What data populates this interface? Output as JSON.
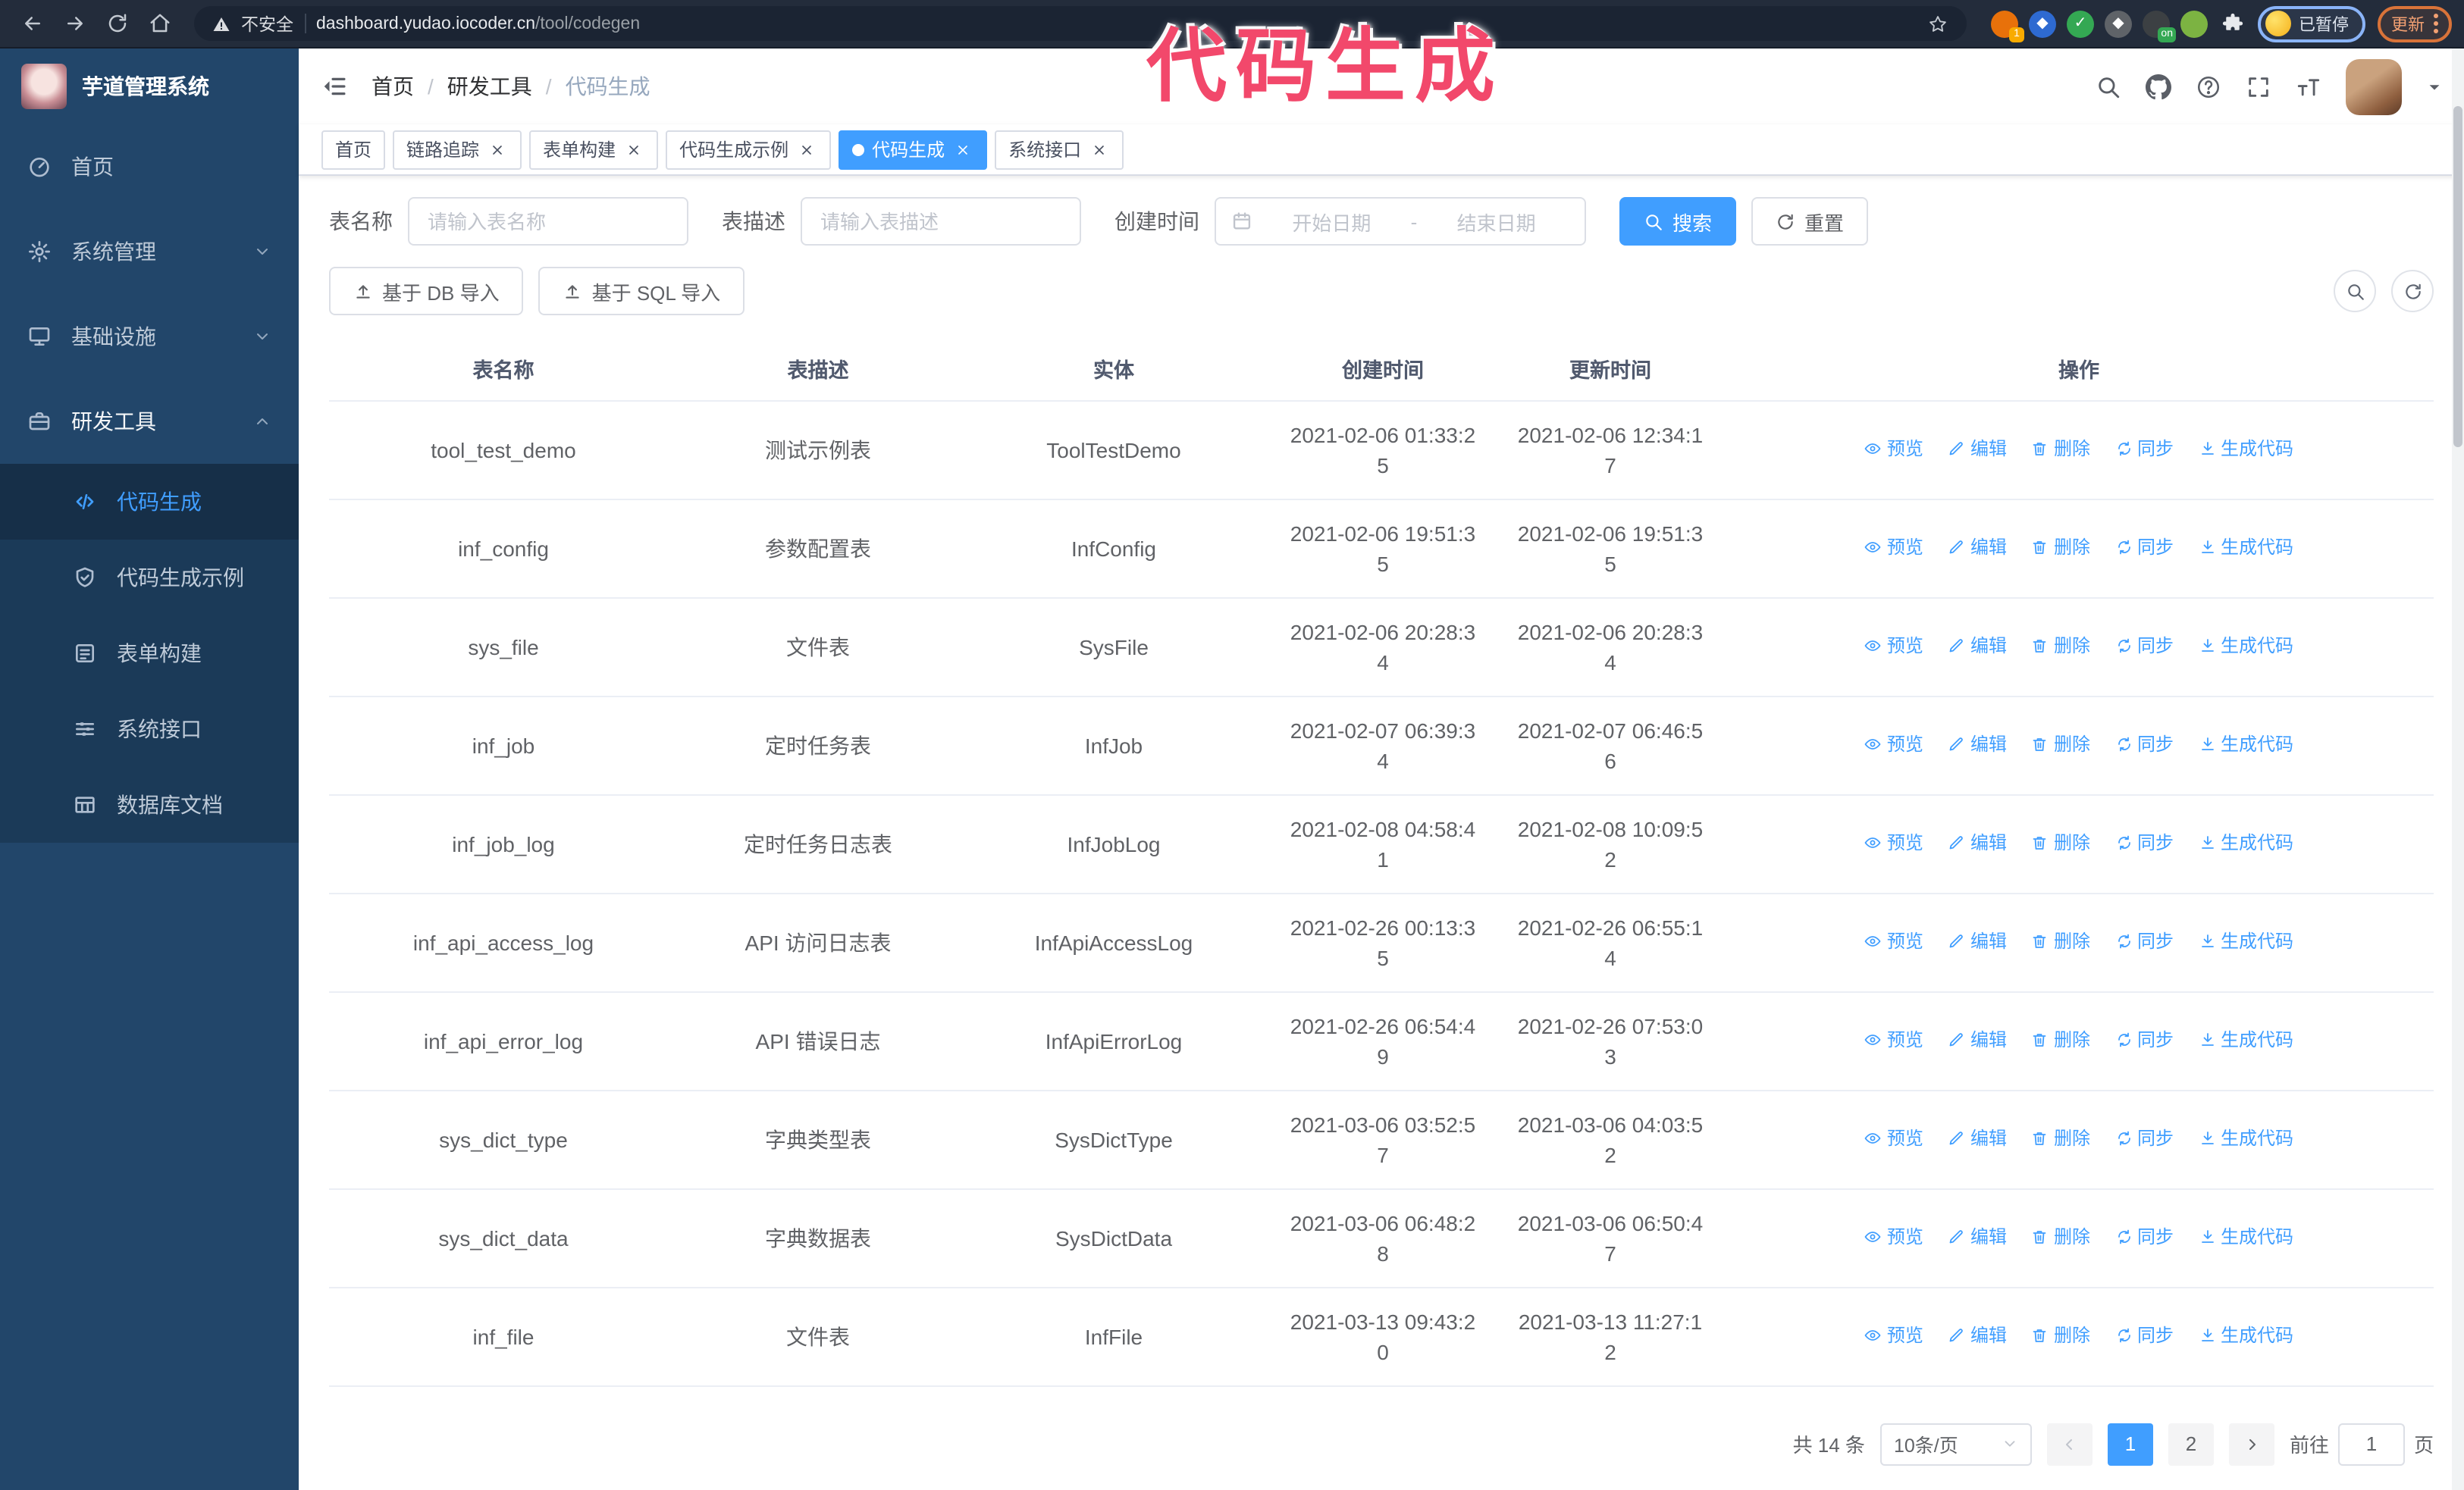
{
  "colors": {
    "primary": "#409eff",
    "sidebar_bg": "#22466a",
    "submenu_bg": "#1b3a58",
    "annotation": "#f2486b"
  },
  "annotation": {
    "text": "代码生成"
  },
  "browser": {
    "nav_icons": [
      "back-icon",
      "forward-icon",
      "reload-icon",
      "home-icon"
    ],
    "security_label": "不安全",
    "url_host": "dashboard.yudao.iocoder.cn",
    "url_path": "/tool/codegen",
    "extensions": [
      {
        "name": "extension-orange-icon",
        "color": "#e8710a",
        "badge": "1",
        "badge_color": "#f9ab00"
      },
      {
        "name": "extension-gem-icon",
        "color": "#2e6ad1",
        "glyph": "◆"
      },
      {
        "name": "extension-check-icon",
        "color": "#34a853",
        "glyph": "✓"
      },
      {
        "name": "extension-grid-icon",
        "color": "#5f6368",
        "glyph": "◆"
      },
      {
        "name": "extension-dark-icon",
        "color": "#3c4043",
        "badge": "on",
        "badge_color": "#34a853"
      },
      {
        "name": "extension-green-icon",
        "color": "#7cb342"
      },
      {
        "name": "puzzle-icon",
        "color": "transparent"
      }
    ],
    "profile": {
      "status_label": "已暂停"
    },
    "update_label": "更新"
  },
  "sidebar": {
    "title": "芋道管理系统",
    "items": [
      {
        "name": "home",
        "label": "首页",
        "icon": "dashboard-icon"
      },
      {
        "name": "system-management",
        "label": "系统管理",
        "icon": "gear-icon",
        "chevron": "down"
      },
      {
        "name": "infrastructure",
        "label": "基础设施",
        "icon": "infrastructure-icon",
        "chevron": "down"
      },
      {
        "name": "dev-tools",
        "label": "研发工具",
        "icon": "toolbox-icon",
        "chevron": "up",
        "expanded": true,
        "children": [
          {
            "name": "code-generation",
            "label": "代码生成",
            "icon": "code-icon",
            "active": true
          },
          {
            "name": "code-generation-example",
            "label": "代码生成示例",
            "icon": "example-icon"
          },
          {
            "name": "form-builder",
            "label": "表单构建",
            "icon": "form-icon"
          },
          {
            "name": "system-api",
            "label": "系统接口",
            "icon": "api-icon"
          },
          {
            "name": "database-doc",
            "label": "数据库文档",
            "icon": "dbdoc-icon"
          }
        ]
      }
    ]
  },
  "header": {
    "breadcrumb": {
      "separator": "/",
      "items": [
        {
          "label": "首页",
          "current": false
        },
        {
          "label": "研发工具",
          "current": false
        },
        {
          "label": "代码生成",
          "current": true
        }
      ]
    },
    "icons": [
      "search-icon",
      "github-icon",
      "question-icon",
      "fullscreen-icon",
      "font-size-icon"
    ]
  },
  "tabs": [
    {
      "label": "首页",
      "closable": false,
      "active": false
    },
    {
      "label": "链路追踪",
      "closable": true,
      "active": false
    },
    {
      "label": "表单构建",
      "closable": true,
      "active": false
    },
    {
      "label": "代码生成示例",
      "closable": true,
      "active": false
    },
    {
      "label": "代码生成",
      "closable": true,
      "active": true
    },
    {
      "label": "系统接口",
      "closable": true,
      "active": false
    }
  ],
  "filters": {
    "table_name_label": "表名称",
    "table_name_placeholder": "请输入表名称",
    "table_desc_label": "表描述",
    "table_desc_placeholder": "请输入表描述",
    "create_time_label": "创建时间",
    "date_start_placeholder": "开始日期",
    "date_separator": "-",
    "date_end_placeholder": "结束日期",
    "search_label": "搜索",
    "reset_label": "重置"
  },
  "toolbar": {
    "import_db_label": "基于 DB 导入",
    "import_sql_label": "基于 SQL 导入"
  },
  "table": {
    "columns": [
      "表名称",
      "表描述",
      "实体",
      "创建时间",
      "更新时间",
      "操作"
    ],
    "actions": [
      {
        "name": "preview",
        "label": "预览",
        "icon": "eye-icon"
      },
      {
        "name": "edit",
        "label": "编辑",
        "icon": "edit-icon"
      },
      {
        "name": "delete",
        "label": "删除",
        "icon": "delete-icon"
      },
      {
        "name": "sync",
        "label": "同步",
        "icon": "sync-icon"
      },
      {
        "name": "generate-code",
        "label": "生成代码",
        "icon": "download-icon"
      }
    ],
    "rows": [
      {
        "name": "tool_test_demo",
        "desc": "测试示例表",
        "entity": "ToolTestDemo",
        "created": "2021-02-06 01:33:25",
        "updated": "2021-02-06 12:34:17"
      },
      {
        "name": "inf_config",
        "desc": "参数配置表",
        "entity": "InfConfig",
        "created": "2021-02-06 19:51:35",
        "updated": "2021-02-06 19:51:35"
      },
      {
        "name": "sys_file",
        "desc": "文件表",
        "entity": "SysFile",
        "created": "2021-02-06 20:28:34",
        "updated": "2021-02-06 20:28:34"
      },
      {
        "name": "inf_job",
        "desc": "定时任务表",
        "entity": "InfJob",
        "created": "2021-02-07 06:39:34",
        "updated": "2021-02-07 06:46:56"
      },
      {
        "name": "inf_job_log",
        "desc": "定时任务日志表",
        "entity": "InfJobLog",
        "created": "2021-02-08 04:58:41",
        "updated": "2021-02-08 10:09:52"
      },
      {
        "name": "inf_api_access_log",
        "desc": "API 访问日志表",
        "entity": "InfApiAccessLog",
        "created": "2021-02-26 00:13:35",
        "updated": "2021-02-26 06:55:14"
      },
      {
        "name": "inf_api_error_log",
        "desc": "API 错误日志",
        "entity": "InfApiErrorLog",
        "created": "2021-02-26 06:54:49",
        "updated": "2021-02-26 07:53:03"
      },
      {
        "name": "sys_dict_type",
        "desc": "字典类型表",
        "entity": "SysDictType",
        "created": "2021-03-06 03:52:57",
        "updated": "2021-03-06 04:03:52"
      },
      {
        "name": "sys_dict_data",
        "desc": "字典数据表",
        "entity": "SysDictData",
        "created": "2021-03-06 06:48:28",
        "updated": "2021-03-06 06:50:47"
      },
      {
        "name": "inf_file",
        "desc": "文件表",
        "entity": "InfFile",
        "created": "2021-03-13 09:43:20",
        "updated": "2021-03-13 11:27:12"
      }
    ]
  },
  "pagination": {
    "total_label": "共 14 条",
    "page_size": "10条/页",
    "pages": [
      "1",
      "2"
    ],
    "active_page": "1",
    "goto_prefix": "前往",
    "goto_value": "1",
    "goto_suffix": "页"
  }
}
